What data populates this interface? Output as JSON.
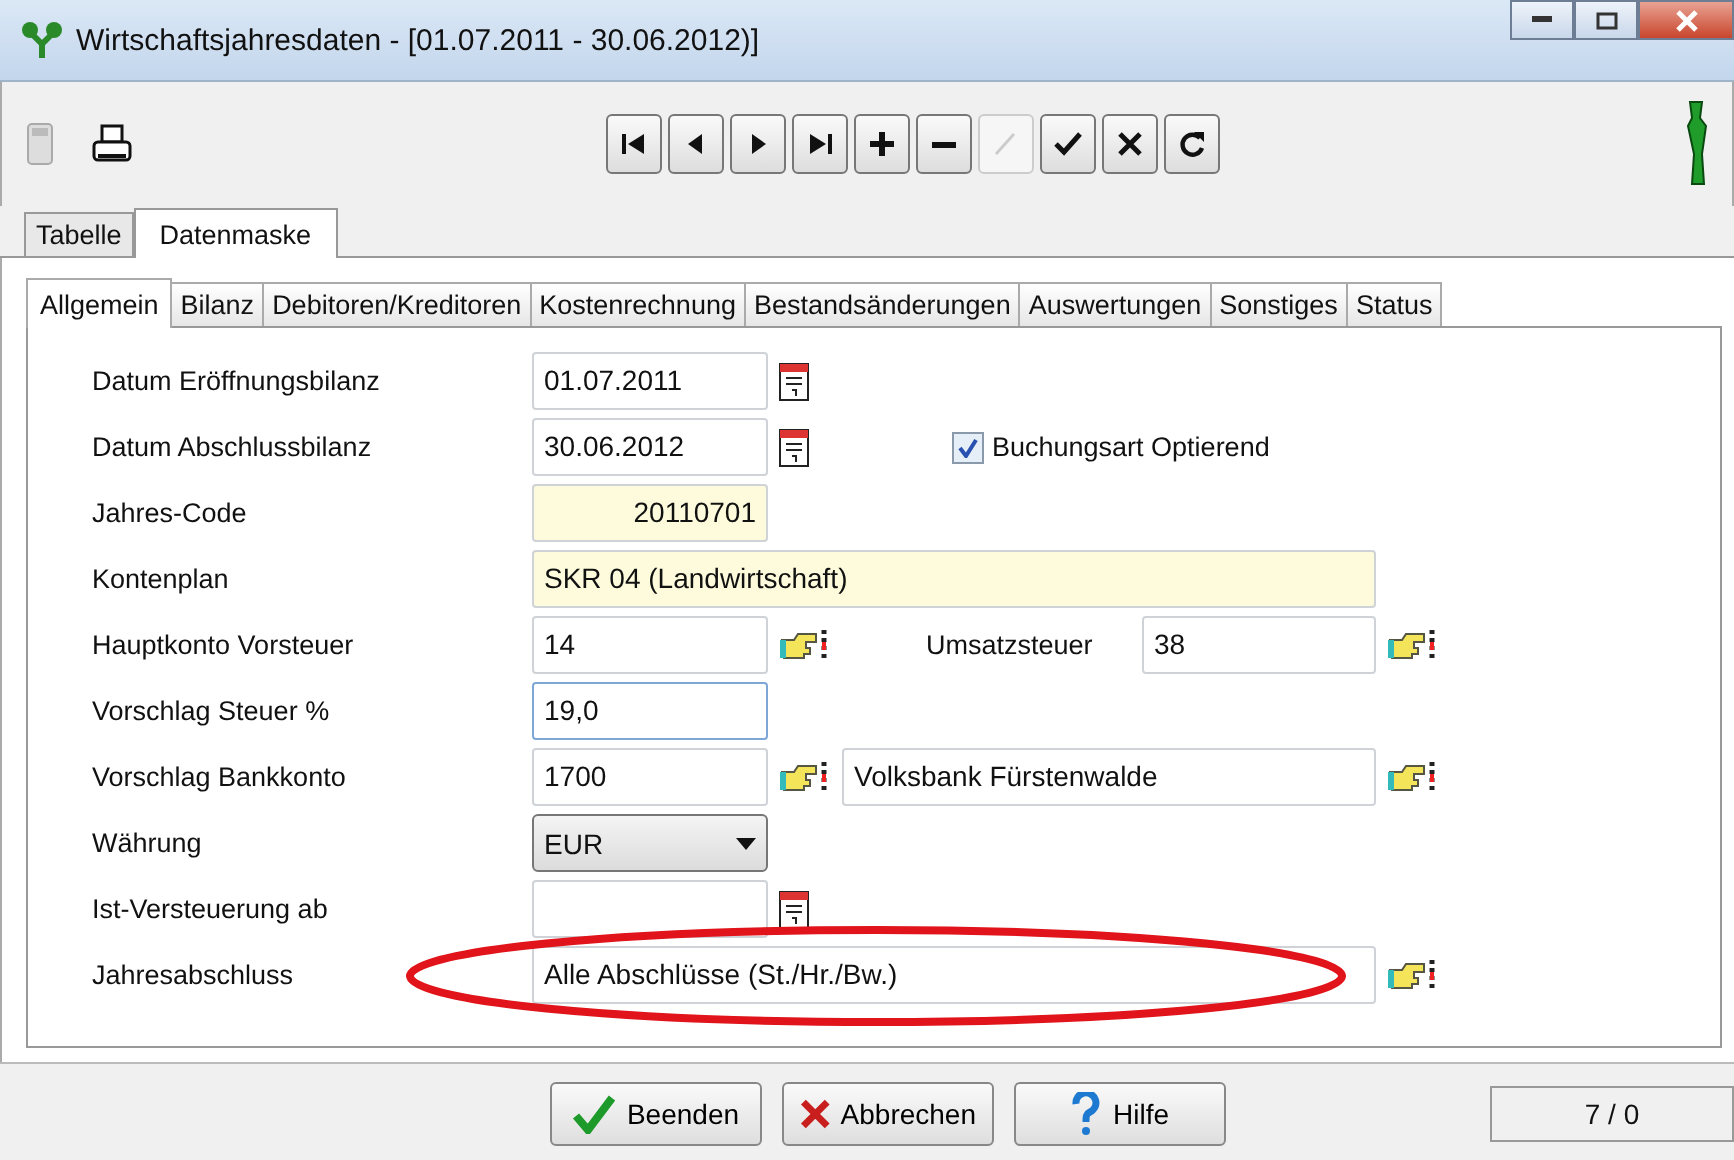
{
  "window": {
    "title": "Wirtschaftsjahresdaten - [01.07.2011 - 30.06.2012)]"
  },
  "toolbar": {
    "nav_buttons": [
      {
        "kind": "first",
        "disabled": false
      },
      {
        "kind": "prev",
        "disabled": false
      },
      {
        "kind": "next",
        "disabled": false
      },
      {
        "kind": "last",
        "disabled": false
      },
      {
        "kind": "add",
        "disabled": false
      },
      {
        "kind": "remove",
        "disabled": false
      },
      {
        "kind": "edit",
        "disabled": true
      },
      {
        "kind": "confirm",
        "disabled": false
      },
      {
        "kind": "cancel",
        "disabled": false
      },
      {
        "kind": "refresh",
        "disabled": false
      }
    ]
  },
  "view_tabs": [
    {
      "label": "Tabelle",
      "selected": false
    },
    {
      "label": "Datenmaske",
      "selected": true
    }
  ],
  "tabs": [
    {
      "label": "Allgemein",
      "selected": true
    },
    {
      "label": "Bilanz",
      "selected": false
    },
    {
      "label": "Debitoren/Kreditoren",
      "selected": false
    },
    {
      "label": "Kostenrechnung",
      "selected": false
    },
    {
      "label": "Bestandsänderungen",
      "selected": false
    },
    {
      "label": "Auswertungen",
      "selected": false
    },
    {
      "label": "Sonstiges",
      "selected": false
    },
    {
      "label": "Status",
      "selected": false
    }
  ],
  "rows": [
    {
      "label": "Datum Eröffnungsbilanz",
      "kind": "date",
      "value": "01.07.2011"
    },
    {
      "label": "Datum Abschlussbilanz",
      "kind": "date",
      "value": "30.06.2012",
      "checkbox": {
        "label": "Buchungsart Optierend",
        "checked": true
      }
    },
    {
      "label": "Jahres-Code",
      "kind": "readonly",
      "value": "20110701"
    },
    {
      "label": "Kontenplan",
      "kind": "readonly_wide",
      "value": "SKR 04 (Landwirtschaft)"
    },
    {
      "label": "Hauptkonto Vorsteuer",
      "kind": "lookup",
      "value": "14",
      "extra": {
        "kind": "labeled_lookup",
        "label": "Umsatzsteuer",
        "value": "38"
      }
    },
    {
      "label": "Vorschlag Steuer %",
      "kind": "text",
      "value": "19,0",
      "focused": true
    },
    {
      "label": "Vorschlag Bankkonto",
      "kind": "lookup",
      "value": "1700",
      "extra": {
        "kind": "name_lookup",
        "value": "Volksbank Fürstenwalde"
      }
    },
    {
      "label": "Währung",
      "kind": "combo",
      "value": "EUR"
    },
    {
      "label": "Ist-Versteuerung ab",
      "kind": "date"
    },
    {
      "label": "Jahresabschluss",
      "kind": "lookup_wide",
      "value": "Alle Abschlüsse (St./Hr./Bw.)",
      "circled": true
    }
  ],
  "buttons": [
    {
      "kind": "finish",
      "label": "Beenden"
    },
    {
      "kind": "cancel",
      "label": "Abbrechen"
    },
    {
      "kind": "help",
      "label": "Hilfe"
    }
  ],
  "status_bar": {
    "record": "7 / 0"
  }
}
